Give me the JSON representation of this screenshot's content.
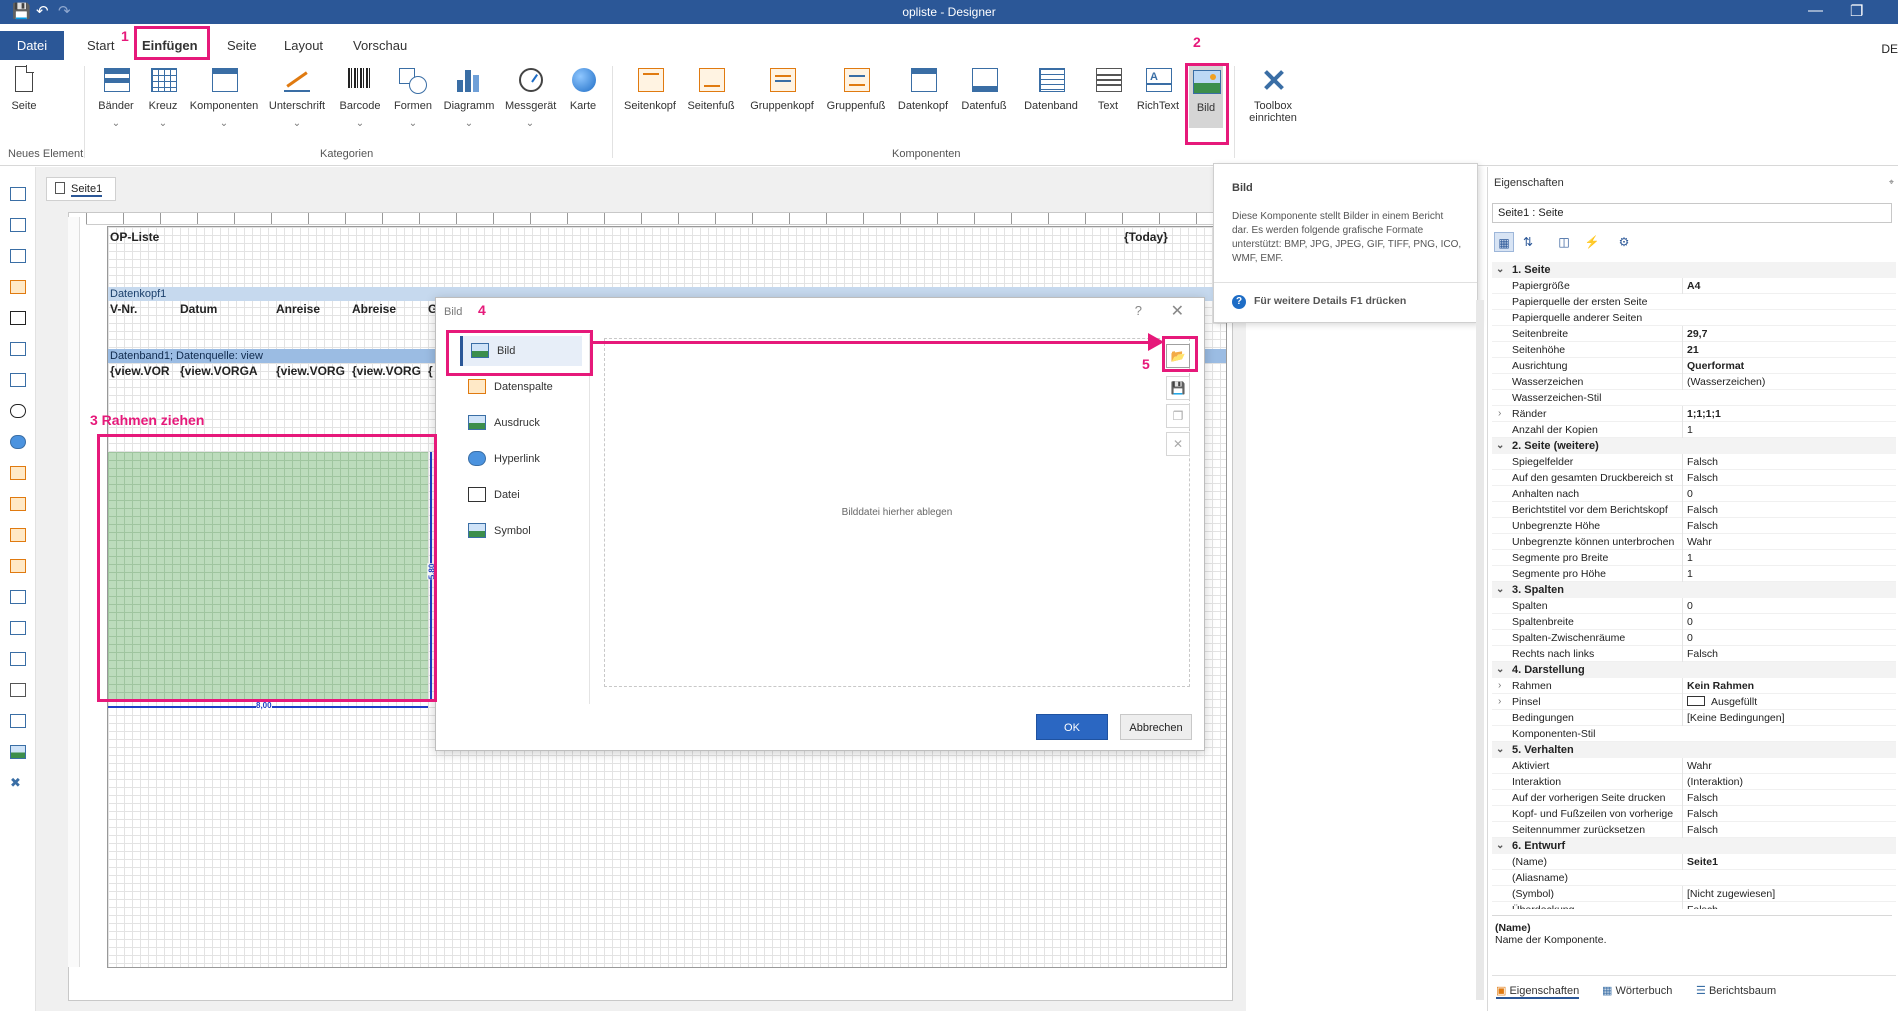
{
  "window": {
    "title": "opliste - Designer"
  },
  "ribbon_tabs": {
    "file": "Datei",
    "start": "Start",
    "insert": "Einfügen",
    "page": "Seite",
    "layout": "Layout",
    "preview": "Vorschau",
    "lang": "DE"
  },
  "ribbon": {
    "new_element": {
      "seite": "Seite",
      "group_label": "Neues Element"
    },
    "categories": {
      "items": [
        "Bänder",
        "Kreuz",
        "Komponenten",
        "Unterschrift",
        "Barcode",
        "Formen",
        "Diagramm",
        "Messgerät",
        "Karte"
      ],
      "group_label": "Kategorien"
    },
    "components": {
      "items": [
        "Seitenkopf",
        "Seitenfuß",
        "Gruppenkopf",
        "Gruppenfuß",
        "Datenkopf",
        "Datenfuß",
        "Datenband",
        "Text",
        "RichText",
        "Bild"
      ],
      "group_label": "Komponenten"
    },
    "toolbox": {
      "line1": "Toolbox",
      "line2": "einrichten"
    }
  },
  "tooltip": {
    "title": "Bild",
    "body": "Diese Komponente stellt Bilder in einem Bericht dar. Es werden folgende grafische Formate unterstützt: BMP, JPG, JPEG, GIF, TIFF, PNG, ICO, WMF, EMF.",
    "help": "Für weitere Details F1 drücken"
  },
  "doc_tab": "Seite1",
  "report": {
    "title": "OP-Liste",
    "today": "{Today}",
    "header_band": "Datenkopf1",
    "columns": [
      "V-Nr.",
      "Datum",
      "Anreise",
      "Abreise",
      "G"
    ],
    "data_band": "Datenband1; Datenquelle: view",
    "fields": [
      "{view.VOR",
      "{view.VORGA",
      "{view.VORG",
      "{view.VORG",
      "{"
    ],
    "dim_height": "5,80",
    "dim_width": "8,00"
  },
  "annotations": {
    "n1": "1",
    "n2": "2",
    "n3": "3 Rahmen ziehen",
    "n4": "4",
    "n5": "5"
  },
  "dialog": {
    "title": "Bild",
    "question": "?",
    "close": "✕",
    "items": [
      "Bild",
      "Datenspalte",
      "Ausdruck",
      "Hyperlink",
      "Datei",
      "Symbol"
    ],
    "drop_text": "Bilddatei hierher ablegen",
    "ok": "OK",
    "cancel": "Abbrechen"
  },
  "props": {
    "header": "Eigenschaften",
    "selector": "Seite1 : Seite",
    "sections": [
      {
        "title": "1. Seite",
        "rows": [
          {
            "n": "Papiergröße",
            "v": "A4",
            "b": true
          },
          {
            "n": "Papierquelle der ersten Seite",
            "v": ""
          },
          {
            "n": "Papierquelle anderer Seiten",
            "v": ""
          },
          {
            "n": "Seitenbreite",
            "v": "29,7",
            "b": true
          },
          {
            "n": "Seitenhöhe",
            "v": "21",
            "b": true
          },
          {
            "n": "Ausrichtung",
            "v": "Querformat",
            "b": true
          },
          {
            "n": "Wasserzeichen",
            "v": "(Wasserzeichen)"
          },
          {
            "n": "Wasserzeichen-Stil",
            "v": ""
          },
          {
            "n": "Ränder",
            "v": "1;1;1;1",
            "b": true,
            "exp": true
          },
          {
            "n": "Anzahl der Kopien",
            "v": "1"
          }
        ]
      },
      {
        "title": "2. Seite (weitere)",
        "rows": [
          {
            "n": "Spiegelfelder",
            "v": "Falsch"
          },
          {
            "n": "Auf den gesamten Druckbereich st",
            "v": "Falsch"
          },
          {
            "n": "Anhalten nach",
            "v": "0"
          },
          {
            "n": "Berichtstitel vor dem Berichtskopf",
            "v": "Falsch"
          },
          {
            "n": "Unbegrenzte Höhe",
            "v": "Falsch"
          },
          {
            "n": "Unbegrenzte können unterbrochen",
            "v": "Wahr"
          },
          {
            "n": "Segmente pro Breite",
            "v": "1"
          },
          {
            "n": "Segmente pro Höhe",
            "v": "1"
          }
        ]
      },
      {
        "title": "3. Spalten",
        "rows": [
          {
            "n": "Spalten",
            "v": "0"
          },
          {
            "n": "Spaltenbreite",
            "v": "0"
          },
          {
            "n": "Spalten-Zwischenräume",
            "v": "0"
          },
          {
            "n": "Rechts nach links",
            "v": "Falsch"
          }
        ]
      },
      {
        "title": "4. Darstellung",
        "rows": [
          {
            "n": "Rahmen",
            "v": "Kein Rahmen",
            "b": true,
            "exp": true
          },
          {
            "n": "Pinsel",
            "v": "Ausgefüllt",
            "exp": true,
            "swatch": true
          },
          {
            "n": "Bedingungen",
            "v": "[Keine Bedingungen]"
          },
          {
            "n": "Komponenten-Stil",
            "v": ""
          }
        ]
      },
      {
        "title": "5. Verhalten",
        "rows": [
          {
            "n": "Aktiviert",
            "v": "Wahr"
          },
          {
            "n": "Interaktion",
            "v": "(Interaktion)"
          },
          {
            "n": "Auf der vorherigen Seite drucken",
            "v": "Falsch"
          },
          {
            "n": "Kopf- und Fußzeilen von vorherige",
            "v": "Falsch"
          },
          {
            "n": "Seitennummer zurücksetzen",
            "v": "Falsch"
          }
        ]
      },
      {
        "title": "6. Entwurf",
        "rows": [
          {
            "n": "(Name)",
            "v": "Seite1",
            "b": true
          },
          {
            "n": "(Aliasname)",
            "v": ""
          },
          {
            "n": "(Symbol)",
            "v": "[Nicht zugewiesen]"
          },
          {
            "n": "Überdeckung",
            "v": "Falsch"
          }
        ]
      }
    ],
    "desc_title": "(Name)",
    "desc_text": "Name der Komponente.",
    "tabs": [
      "Eigenschaften",
      "Wörterbuch",
      "Berichtsbaum"
    ]
  },
  "colors": {
    "accent": "#2b5797",
    "highlight": "#e6197a",
    "selection_green": "#bcdcbc"
  }
}
